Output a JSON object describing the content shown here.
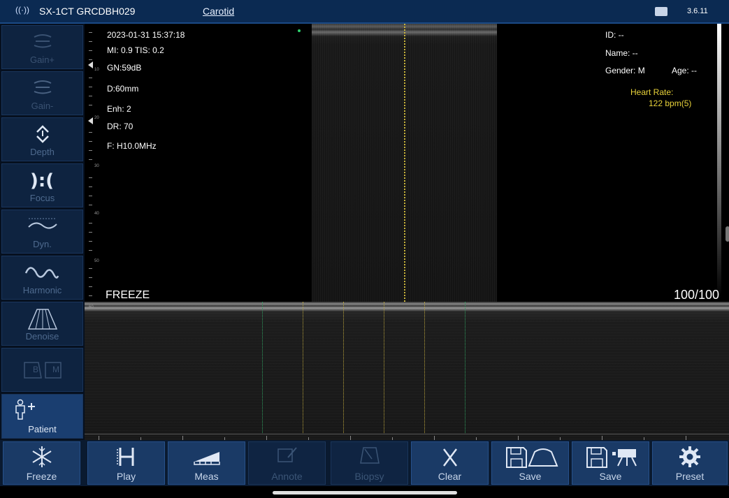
{
  "topbar": {
    "model": "SX-1CT GRCDBH029",
    "preset": "Carotid",
    "version": "3.6.11"
  },
  "sidebar": {
    "items": [
      {
        "label": "Gain+"
      },
      {
        "label": "Gain-"
      },
      {
        "label": "Depth"
      },
      {
        "label": "Focus"
      },
      {
        "label": "Dyn."
      },
      {
        "label": "Harmonic"
      },
      {
        "label": "Denoise"
      },
      {
        "label": "B"
      },
      {
        "label": "M"
      },
      {
        "label": "Patient"
      }
    ]
  },
  "scan_info": {
    "datetime": "2023-01-31 15:37:18",
    "mi_tis": "MI: 0.9  TIS: 0.2",
    "gain": "GN:59dB",
    "depth": "D:60mm",
    "enhancement": "Enh: 2",
    "dynamic_range": "DR: 70",
    "frequency": "F: H10.0MHz"
  },
  "ruler_labels": [
    "10",
    "20",
    "30",
    "40",
    "50",
    "60"
  ],
  "patient": {
    "id": "ID: --",
    "name": "Name: --",
    "gender": "Gender: M",
    "age": "Age: --",
    "heart_rate_label": "Heart Rate:",
    "heart_rate_value": "122 bpm(5)"
  },
  "status": {
    "freeze": "FREEZE",
    "frame_count": "100/100"
  },
  "bottombar": {
    "freeze": "Freeze",
    "play": "Play",
    "meas": "Meas",
    "annote": "Annote",
    "biopsy": "Biopsy",
    "clear": "Clear",
    "save_image": "Save",
    "save_cine": "Save",
    "preset": "Preset"
  },
  "colors": {
    "accent": "#1a3a66",
    "cursor": "#c8b43a",
    "heart_rate": "#e8d23a",
    "green_marker": "#2ed06c"
  }
}
